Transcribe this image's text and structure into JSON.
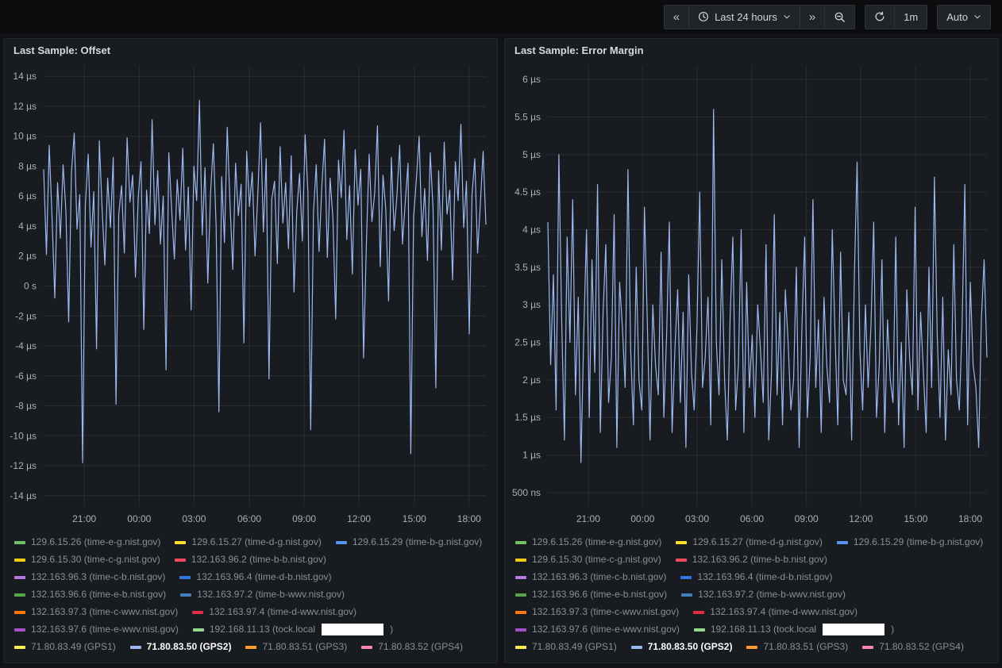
{
  "toolbar": {
    "time_range_label": "Last 24 hours",
    "refresh_interval_label": "1m",
    "auto_dropdown_label": "Auto"
  },
  "legend": {
    "items": [
      {
        "label": "129.6.15.26 (time-e-g.nist.gov)",
        "color": "#73BF69",
        "active": false
      },
      {
        "label": "129.6.15.27 (time-d-g.nist.gov)",
        "color": "#FADE2A",
        "active": false
      },
      {
        "label": "129.6.15.29 (time-b-g.nist.gov)",
        "color": "#5794F2",
        "active": false
      },
      {
        "label": "129.6.15.30 (time-c-g.nist.gov)",
        "color": "#F2CC0C",
        "active": false
      },
      {
        "label": "132.163.96.2 (time-b-b.nist.gov)",
        "color": "#F2495C",
        "active": false
      },
      {
        "label": "132.163.96.3 (time-c-b.nist.gov)",
        "color": "#B877D9",
        "active": false
      },
      {
        "label": "132.163.96.4 (time-d-b.nist.gov)",
        "color": "#3274D9",
        "active": false
      },
      {
        "label": "132.163.96.6 (time-e-b.nist.gov)",
        "color": "#56A64B",
        "active": false
      },
      {
        "label": "132.163.97.2 (time-b-wwv.nist.gov)",
        "color": "#447EBC",
        "active": false
      },
      {
        "label": "132.163.97.3 (time-c-wwv.nist.gov)",
        "color": "#FF780A",
        "active": false
      },
      {
        "label": "132.163.97.4 (time-d-wwv.nist.gov)",
        "color": "#E02F44",
        "active": false
      },
      {
        "label": "132.163.97.6 (time-e-wwv.nist.gov)",
        "color": "#A352CC",
        "active": false
      },
      {
        "label": "192.168.11.13 (tock.local",
        "label_suffix": ")",
        "color": "#96D98D",
        "active": false,
        "redacted": true
      },
      {
        "label": "71.80.83.49 (GPS1)",
        "color": "#FFEE52",
        "active": false
      },
      {
        "label": "71.80.83.50 (GPS2)",
        "color": "#9DB8F0",
        "active": true
      },
      {
        "label": "71.80.83.51 (GPS3)",
        "color": "#FF9830",
        "active": false
      },
      {
        "label": "71.80.83.52 (GPS4)",
        "color": "#FF85B5",
        "active": false
      }
    ]
  },
  "chart_data": [
    {
      "type": "line",
      "title": "Last Sample: Offset",
      "margin_left": 50,
      "ylim": [
        -14.7,
        14.7
      ],
      "grid": true,
      "legend_position": "bottom",
      "y_ticks": [
        {
          "label": "14 µs",
          "v": 14
        },
        {
          "label": "12 µs",
          "v": 12
        },
        {
          "label": "10 µs",
          "v": 10
        },
        {
          "label": "8 µs",
          "v": 8
        },
        {
          "label": "6 µs",
          "v": 6
        },
        {
          "label": "4 µs",
          "v": 4
        },
        {
          "label": "2 µs",
          "v": 2
        },
        {
          "label": "0 s",
          "v": 0
        },
        {
          "label": "-2 µs",
          "v": -2
        },
        {
          "label": "-4 µs",
          "v": -4
        },
        {
          "label": "-6 µs",
          "v": -6
        },
        {
          "label": "-8 µs",
          "v": -8
        },
        {
          "label": "-10 µs",
          "v": -10
        },
        {
          "label": "-12 µs",
          "v": -12
        },
        {
          "label": "-14 µs",
          "v": -14
        }
      ],
      "x_ticks": [
        {
          "label": "21:00",
          "f": 0.092
        },
        {
          "label": "00:00",
          "f": 0.216
        },
        {
          "label": "03:00",
          "f": 0.34
        },
        {
          "label": "06:00",
          "f": 0.465
        },
        {
          "label": "09:00",
          "f": 0.589
        },
        {
          "label": "12:00",
          "f": 0.713
        },
        {
          "label": "15:00",
          "f": 0.838
        },
        {
          "label": "18:00",
          "f": 0.962
        }
      ],
      "series": [
        {
          "name": "71.80.83.50 (GPS2)",
          "color": "#9DB8F0",
          "unit": "µs",
          "values": [
            7.8,
            2.1,
            9.4,
            4.6,
            -0.8,
            6.9,
            3.2,
            8.1,
            5.0,
            -2.4,
            7.6,
            10.2,
            3.8,
            6.1,
            -11.8,
            5.4,
            8.8,
            2.6,
            6.3,
            -4.2,
            9.7,
            5.1,
            1.4,
            7.2,
            3.9,
            8.6,
            -7.9,
            4.8,
            6.7,
            2.2,
            9.9,
            5.6,
            7.4,
            0.6,
            5.9,
            8.3,
            -2.9,
            6.4,
            3.5,
            11.1,
            4.1,
            7.7,
            2.8,
            6.0,
            -5.6,
            8.9,
            5.2,
            1.8,
            7.1,
            4.4,
            9.2,
            2.4,
            6.6,
            -1.6,
            8.0,
            5.7,
            12.4,
            3.4,
            7.9,
            0.2,
            6.2,
            9.5,
            4.0,
            -8.4,
            7.3,
            2.9,
            10.6,
            5.5,
            1.1,
            8.2,
            4.7,
            6.8,
            -3.8,
            9.0,
            5.3,
            7.6,
            2.0,
            6.1,
            10.9,
            3.6,
            8.5,
            -6.2,
            5.8,
            7.0,
            1.5,
            9.3,
            4.2,
            6.9,
            2.5,
            8.7,
            -0.4,
            5.0,
            7.5,
            3.0,
            10.1,
            6.3,
            -9.6,
            4.9,
            8.1,
            2.3,
            6.6,
            9.8,
            1.9,
            7.2,
            4.5,
            -2.2,
            8.4,
            5.9,
            10.4,
            3.1,
            6.7,
            0.8,
            9.1,
            5.4,
            7.8,
            -4.8,
            2.7,
            8.8,
            4.3,
            6.2,
            10.7,
            1.3,
            7.4,
            5.1,
            -1.0,
            8.6,
            3.7,
            6.0,
            9.4,
            2.8,
            5.6,
            8.2,
            -11.2,
            4.6,
            7.1,
            10.0,
            3.3,
            6.5,
            1.7,
            8.9,
            5.2,
            -6.8,
            7.7,
            2.4,
            9.6,
            4.8,
            6.4,
            0.4,
            8.3,
            5.7,
            10.8,
            3.9,
            7.0,
            -3.2,
            6.1,
            8.5,
            2.2,
            5.5,
            9.0,
            4.1
          ]
        }
      ]
    },
    {
      "type": "line",
      "title": "Last Sample: Error Margin",
      "margin_left": 54,
      "ylim": [
        0.32,
        6.18
      ],
      "grid": true,
      "legend_position": "bottom",
      "y_ticks": [
        {
          "label": "6 µs",
          "v": 6
        },
        {
          "label": "5.5 µs",
          "v": 5.5
        },
        {
          "label": "5 µs",
          "v": 5
        },
        {
          "label": "4.5 µs",
          "v": 4.5
        },
        {
          "label": "4 µs",
          "v": 4
        },
        {
          "label": "3.5 µs",
          "v": 3.5
        },
        {
          "label": "3 µs",
          "v": 3
        },
        {
          "label": "2.5 µs",
          "v": 2.5
        },
        {
          "label": "2 µs",
          "v": 2
        },
        {
          "label": "1.5 µs",
          "v": 1.5
        },
        {
          "label": "1 µs",
          "v": 1
        },
        {
          "label": "500 ns",
          "v": 0.5
        }
      ],
      "x_ticks": [
        {
          "label": "21:00",
          "f": 0.092
        },
        {
          "label": "00:00",
          "f": 0.216
        },
        {
          "label": "03:00",
          "f": 0.34
        },
        {
          "label": "06:00",
          "f": 0.465
        },
        {
          "label": "09:00",
          "f": 0.589
        },
        {
          "label": "12:00",
          "f": 0.713
        },
        {
          "label": "15:00",
          "f": 0.838
        },
        {
          "label": "18:00",
          "f": 0.962
        }
      ],
      "series": [
        {
          "name": "71.80.83.50 (GPS2)",
          "color": "#9DB8F0",
          "unit": "µs",
          "values": [
            4.1,
            2.2,
            3.4,
            1.6,
            5.0,
            2.8,
            1.2,
            3.9,
            2.5,
            4.4,
            1.8,
            3.1,
            0.9,
            2.6,
            4.0,
            1.5,
            3.6,
            2.1,
            4.6,
            1.3,
            2.9,
            3.8,
            1.7,
            2.3,
            4.2,
            1.1,
            3.3,
            2.7,
            1.9,
            4.8,
            2.4,
            1.4,
            3.5,
            2.0,
            1.6,
            4.3,
            2.8,
            1.2,
            3.0,
            2.2,
            1.8,
            3.7,
            1.5,
            2.6,
            4.1,
            1.3,
            2.4,
            3.2,
            1.7,
            2.9,
            1.1,
            3.4,
            2.1,
            1.6,
            2.7,
            4.5,
            1.9,
            2.3,
            3.1,
            1.4,
            5.6,
            2.5,
            1.8,
            3.6,
            2.0,
            1.2,
            2.8,
            3.9,
            1.6,
            2.2,
            4.0,
            1.3,
            3.3,
            1.9,
            2.6,
            1.5,
            3.0,
            2.4,
            1.7,
            3.8,
            1.2,
            2.1,
            4.2,
            1.8,
            2.9,
            1.4,
            3.2,
            2.5,
            1.6,
            2.0,
            3.5,
            1.1,
            2.7,
            3.9,
            1.5,
            2.3,
            4.4,
            1.9,
            2.8,
            1.3,
            3.1,
            2.2,
            1.7,
            4.0,
            2.6,
            1.4,
            3.7,
            2.0,
            1.8,
            2.9,
            1.2,
            3.4,
            4.9,
            2.4,
            1.6,
            3.0,
            1.9,
            2.7,
            4.1,
            1.5,
            2.2,
            3.6,
            1.3,
            2.8,
            2.0,
            1.7,
            3.9,
            1.4,
            2.5,
            1.1,
            3.2,
            2.3,
            1.8,
            4.3,
            1.6,
            2.9,
            2.1,
            1.3,
            3.5,
            1.9,
            4.7,
            2.6,
            1.5,
            3.1,
            1.2,
            2.4,
            1.8,
            3.8,
            2.0,
            1.6,
            2.7,
            4.6,
            1.4,
            3.3,
            2.2,
            1.9,
            1.1,
            2.8,
            3.6,
            2.3
          ]
        }
      ]
    }
  ]
}
